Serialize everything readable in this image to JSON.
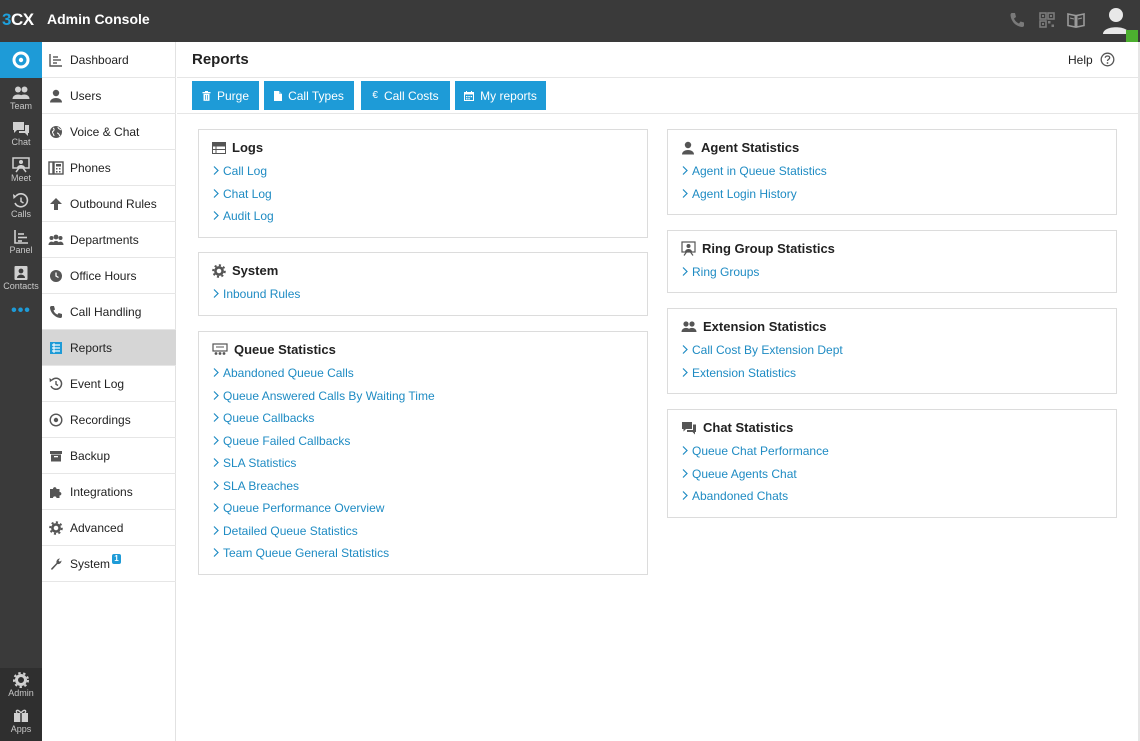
{
  "topbar": {
    "logo_3": "3",
    "logo_cx": "CX",
    "title": "Admin Console",
    "icons": [
      "phone-icon",
      "qr-code-icon",
      "book-icon",
      "user-avatar-icon"
    ],
    "status_color": "#4caf2f"
  },
  "rail": {
    "items": [
      {
        "label": "Team",
        "icon": "team-icon"
      },
      {
        "label": "Chat",
        "icon": "chat-icon"
      },
      {
        "label": "Meet",
        "icon": "meet-icon"
      },
      {
        "label": "Calls",
        "icon": "calls-icon"
      },
      {
        "label": "Panel",
        "icon": "panel-icon"
      },
      {
        "label": "Contacts",
        "icon": "contacts-icon"
      }
    ],
    "more": "•••",
    "bottom": [
      {
        "label": "Admin",
        "icon": "gear-icon"
      },
      {
        "label": "Apps",
        "icon": "apps-icon"
      }
    ]
  },
  "nav": {
    "items": [
      {
        "label": "Dashboard",
        "icon": "dashboard-icon"
      },
      {
        "label": "Users",
        "icon": "user-icon"
      },
      {
        "label": "Voice & Chat",
        "icon": "globe-icon"
      },
      {
        "label": "Phones",
        "icon": "phone-device-icon"
      },
      {
        "label": "Outbound Rules",
        "icon": "arrow-up-icon"
      },
      {
        "label": "Departments",
        "icon": "departments-icon"
      },
      {
        "label": "Office Hours",
        "icon": "clock-icon"
      },
      {
        "label": "Call Handling",
        "icon": "phone-handset-icon"
      },
      {
        "label": "Reports",
        "icon": "reports-icon",
        "active": true
      },
      {
        "label": "Event Log",
        "icon": "history-icon"
      },
      {
        "label": "Recordings",
        "icon": "record-icon"
      },
      {
        "label": "Backup",
        "icon": "backup-icon"
      },
      {
        "label": "Integrations",
        "icon": "puzzle-icon"
      },
      {
        "label": "Advanced",
        "icon": "gear-icon"
      },
      {
        "label": "System",
        "icon": "wrench-icon",
        "badge": "1"
      }
    ]
  },
  "header": {
    "title": "Reports",
    "help_label": "Help"
  },
  "toolbar": {
    "buttons": [
      {
        "label": "Purge",
        "icon": "trash-icon"
      },
      {
        "label": "Call Types",
        "icon": "file-icon"
      },
      {
        "label": "Call Costs",
        "icon": "euro-icon"
      },
      {
        "label": "My reports",
        "icon": "calendar-icon"
      }
    ]
  },
  "sections": {
    "logs": {
      "title": "Logs",
      "links": [
        "Call Log",
        "Chat Log",
        "Audit Log"
      ]
    },
    "system": {
      "title": "System",
      "links": [
        "Inbound Rules"
      ]
    },
    "queue": {
      "title": "Queue Statistics",
      "links": [
        "Abandoned Queue Calls",
        "Queue Answered Calls By Waiting Time",
        "Queue Callbacks",
        "Queue Failed Callbacks",
        "SLA Statistics",
        "SLA Breaches",
        "Queue Performance Overview",
        "Detailed Queue Statistics",
        "Team Queue General Statistics"
      ]
    },
    "agent": {
      "title": "Agent Statistics",
      "links": [
        "Agent in Queue Statistics",
        "Agent Login History"
      ]
    },
    "ring": {
      "title": "Ring Group Statistics",
      "links": [
        "Ring Groups"
      ]
    },
    "extension": {
      "title": "Extension Statistics",
      "links": [
        "Call Cost By Extension Dept",
        "Extension Statistics"
      ]
    },
    "chat": {
      "title": "Chat Statistics",
      "links": [
        "Queue Chat Performance",
        "Queue Agents Chat",
        "Abandoned Chats"
      ]
    }
  },
  "colors": {
    "accent": "#1e9bd7",
    "link": "#1e8bc3",
    "topbar": "#3a3a3a"
  }
}
